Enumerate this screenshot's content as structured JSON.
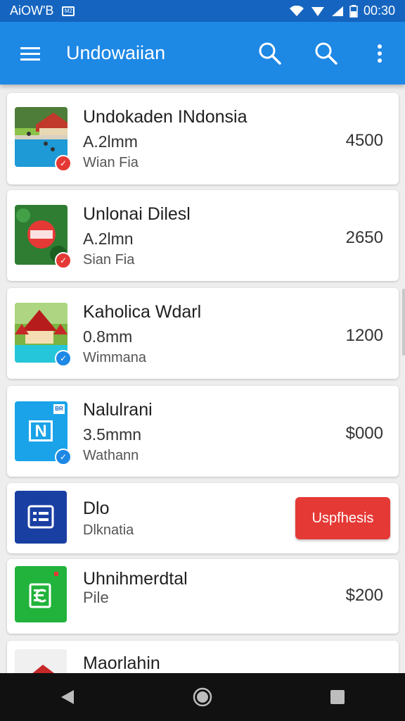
{
  "status_bar": {
    "carrier": "AiOW'B",
    "notification_label": "M2",
    "time": "00:30"
  },
  "app_bar": {
    "title": "Undowaiian",
    "menu_icon": "menu-icon",
    "search_icon": "search-icon",
    "more_icon": "more-vert-icon"
  },
  "items": [
    {
      "title": "Undokaden INdonsia",
      "subtitle": "A.2lmm",
      "meta": "Wian Fia",
      "price": "4500",
      "badge_icon": "check-icon",
      "badge_color": "#e53935"
    },
    {
      "title": "Unlonai Dilesl",
      "subtitle": "A.2lmn",
      "meta": "Sian Fia",
      "price": "2650",
      "badge_icon": "check-icon",
      "badge_color": "#e53935"
    },
    {
      "title": "Kaholica Wdarl",
      "subtitle": "0.8mm",
      "meta": "Wimmana",
      "price": "1200",
      "badge_icon": "check-icon",
      "badge_color": "#1e88e5"
    },
    {
      "title": "Nalulrani",
      "subtitle": "3.5mmn",
      "meta": "Wathann",
      "price": "$000",
      "thumb_label": "N",
      "thumb_corner": "BR",
      "badge_icon": "check-icon",
      "badge_color": "#1e88e5"
    },
    {
      "title": "Dlo",
      "meta": "Dlknatia",
      "button_label": "Uspfhesis",
      "button_color": "#e53935"
    },
    {
      "title": "Uhnihmerdtal",
      "meta": "Pile",
      "price": "$200"
    },
    {
      "title": "Maorlahin"
    }
  ],
  "nav_bar": {
    "back_icon": "back-triangle-icon",
    "home_icon": "home-circle-icon",
    "recents_icon": "recents-square-icon"
  }
}
